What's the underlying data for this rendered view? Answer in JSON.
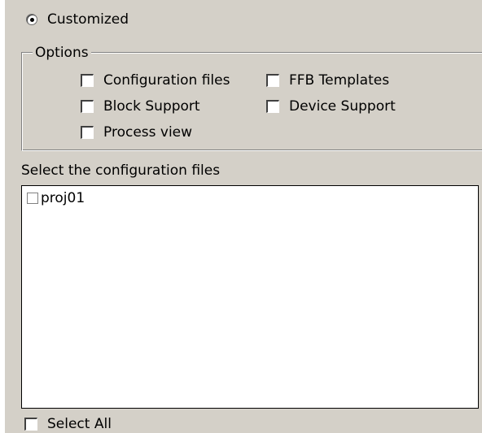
{
  "mode": {
    "label": "Customized",
    "selected": true
  },
  "options": {
    "legend": "Options",
    "items": [
      {
        "label": "Configuration files",
        "checked": false
      },
      {
        "label": "FFB Templates",
        "checked": false
      },
      {
        "label": "Block Support",
        "checked": false
      },
      {
        "label": "Device Support",
        "checked": false
      },
      {
        "label": "Process view",
        "checked": false
      }
    ]
  },
  "config_files": {
    "label": "Select the configuration files",
    "items": [
      {
        "label": "proj01",
        "checked": false
      }
    ]
  },
  "select_all": {
    "label": "Select All",
    "checked": false
  }
}
